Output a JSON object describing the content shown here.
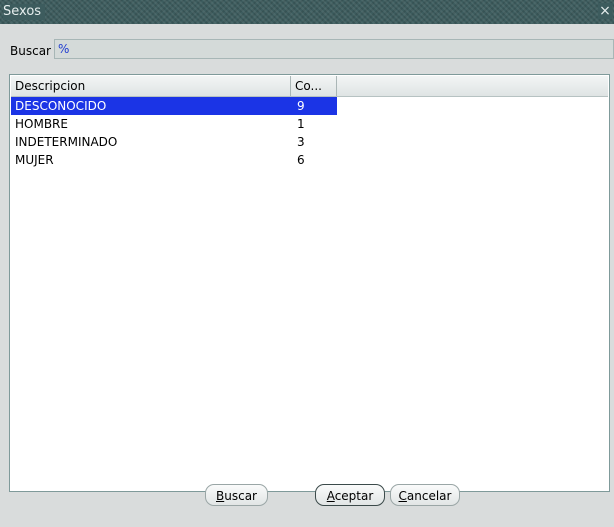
{
  "window": {
    "title": "Sexos",
    "close_glyph": "×"
  },
  "search": {
    "label": "Buscar",
    "value": "%"
  },
  "list": {
    "columns": [
      "Descripcion",
      "Co..."
    ],
    "rows": [
      {
        "desc": "DESCONOCIDO",
        "code": "9",
        "selected": true
      },
      {
        "desc": "HOMBRE",
        "code": "1",
        "selected": false
      },
      {
        "desc": "INDETERMINADO",
        "code": "3",
        "selected": false
      },
      {
        "desc": "MUJER",
        "code": "6",
        "selected": false
      }
    ]
  },
  "buttons": {
    "buscar": {
      "mnemonic": "B",
      "rest": "uscar"
    },
    "aceptar": {
      "mnemonic": "A",
      "rest": "ceptar"
    },
    "cancelar": {
      "mnemonic": "C",
      "rest": "ancelar"
    }
  },
  "colors": {
    "titlebar": "#3d5c5e",
    "selection": "#1b34e6",
    "dialog_bg": "#d9dcdc"
  }
}
